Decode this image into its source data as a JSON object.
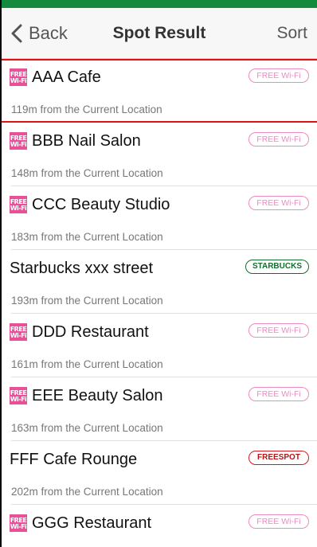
{
  "colors": {
    "top_bar": "#138a3c",
    "highlight": "#e01212",
    "wifi_icon": "#e8509a",
    "badge_wifi": "#f08ac3",
    "badge_starbucks": "#0f6e2b",
    "badge_freespot": "#d6191c"
  },
  "navbar": {
    "back_label": "Back",
    "back_icon": "chevron-left-icon",
    "title": "Spot Result",
    "sort_label": "Sort"
  },
  "wifi_icon": {
    "line1": "FREE",
    "line2": "Wi-Fi"
  },
  "spots": [
    {
      "name": "AAA Cafe",
      "distance": "119m from the Current Location",
      "badge": "FREE Wi-Fi",
      "badge_type": "wifi",
      "wifi_icon": true
    },
    {
      "name": "BBB Nail Salon",
      "distance": "148m from the Current Location",
      "badge": "FREE Wi-Fi",
      "badge_type": "wifi",
      "wifi_icon": true
    },
    {
      "name": "CCC Beauty Studio",
      "distance": "183m from the Current Location",
      "badge": "FREE Wi-Fi",
      "badge_type": "wifi",
      "wifi_icon": true
    },
    {
      "name": "Starbucks xxx street",
      "distance": "193m from the Current Location",
      "badge": "STARBUCKS",
      "badge_type": "starbucks",
      "wifi_icon": false
    },
    {
      "name": "DDD Restaurant",
      "distance": "161m from the Current Location",
      "badge": "FREE Wi-Fi",
      "badge_type": "wifi",
      "wifi_icon": true
    },
    {
      "name": "EEE Beauty Salon",
      "distance": "163m from the Current Location",
      "badge": "FREE Wi-Fi",
      "badge_type": "wifi",
      "wifi_icon": true
    },
    {
      "name": "FFF Cafe Rounge",
      "distance": "202m from the Current Location",
      "badge": "FREESPOT",
      "badge_type": "freespot",
      "wifi_icon": false
    },
    {
      "name": "GGG Restaurant",
      "distance": "",
      "badge": "FREE Wi-Fi",
      "badge_type": "wifi",
      "wifi_icon": true
    }
  ]
}
